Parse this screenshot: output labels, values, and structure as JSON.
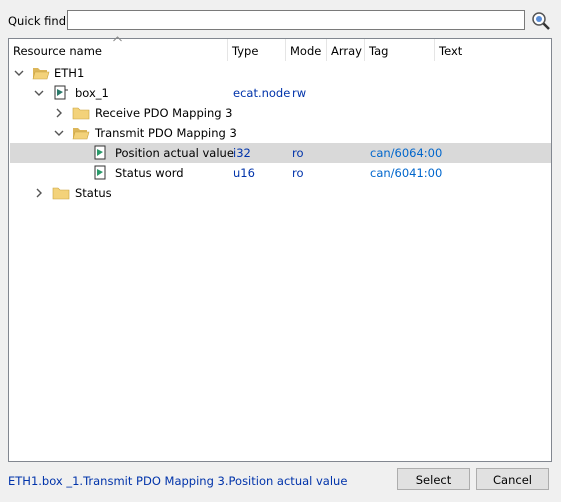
{
  "quick_find": {
    "label": "Quick find:",
    "value": ""
  },
  "columns": [
    "Resource name",
    "Type",
    "Mode",
    "Array",
    "Tag",
    "Text"
  ],
  "tree": [
    {
      "name": "ETH1",
      "type": "",
      "mode": "",
      "tag": "",
      "icon": "folder-open-icon"
    },
    {
      "name": "box_1",
      "type": "ecat.node",
      "mode": "rw",
      "tag": "",
      "icon": "device-node-icon"
    },
    {
      "name": "Receive PDO Mapping 3",
      "type": "",
      "mode": "",
      "tag": "",
      "icon": "folder-icon"
    },
    {
      "name": "Transmit PDO Mapping 3",
      "type": "",
      "mode": "",
      "tag": "",
      "icon": "folder-open-icon"
    },
    {
      "name": "Position actual value",
      "type": "i32",
      "mode": "ro",
      "tag": "can/6064:00",
      "icon": "variable-icon",
      "selected": true
    },
    {
      "name": "Status word",
      "type": "u16",
      "mode": "ro",
      "tag": "can/6041:00",
      "icon": "variable-icon"
    },
    {
      "name": "Status",
      "type": "",
      "mode": "",
      "tag": "",
      "icon": "folder-icon"
    }
  ],
  "status_path": "ETH1.box _1.Transmit PDO Mapping 3.Position actual value",
  "buttons": {
    "select": "Select",
    "cancel": "Cancel"
  },
  "colors": {
    "link": "#0066cc",
    "type_text": "#0033aa",
    "selection": "#d9d9d9",
    "folder": "#f3d27a"
  }
}
